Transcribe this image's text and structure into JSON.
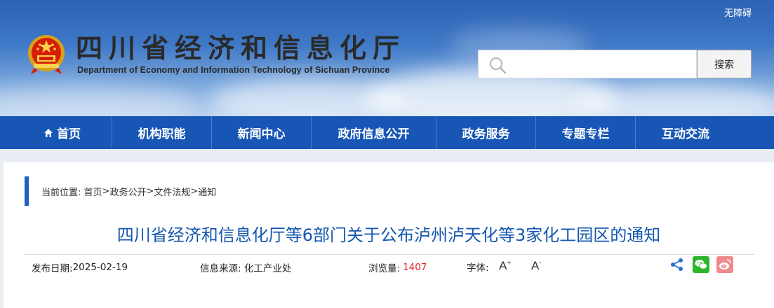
{
  "header": {
    "accessibility_link": "无障碍",
    "title_cn": "四川省经济和信息化厅",
    "title_en": "Department of Economy and Information Technology of Sichuan Province",
    "search_placeholder": "",
    "search_button": "搜索"
  },
  "nav": {
    "items": [
      {
        "label": "首页",
        "icon": "home-icon"
      },
      {
        "label": "机构职能"
      },
      {
        "label": "新闻中心"
      },
      {
        "label": "政府信息公开"
      },
      {
        "label": "政务服务"
      },
      {
        "label": "专题专栏"
      },
      {
        "label": "互动交流"
      }
    ]
  },
  "breadcrumb": {
    "prefix": "当前位置:",
    "items": [
      "首页",
      "政务公开",
      "文件法规",
      "通知"
    ],
    "separator": ">"
  },
  "article": {
    "title": "四川省经济和信息化厅等6部门关于公布泸州泸天化等3家化工园区的通知",
    "publish_label": "发布日期:",
    "publish_date": "2025-02-19",
    "source_label": "信息来源:",
    "source_value": "化工产业处",
    "views_label": "浏览量:",
    "views_value": "1407",
    "font_label": "字体:",
    "font_increase": "A",
    "font_decrease": "A",
    "font_increase_sign": "+",
    "font_decrease_sign": "-"
  },
  "share": {
    "icons": [
      "share-icon",
      "wechat-icon",
      "weibo-icon"
    ]
  },
  "colors": {
    "nav_bg": "#1756b5",
    "title": "#1657b0",
    "views": "#e02020",
    "breadcrumb_bar": "#1e5fbf"
  }
}
